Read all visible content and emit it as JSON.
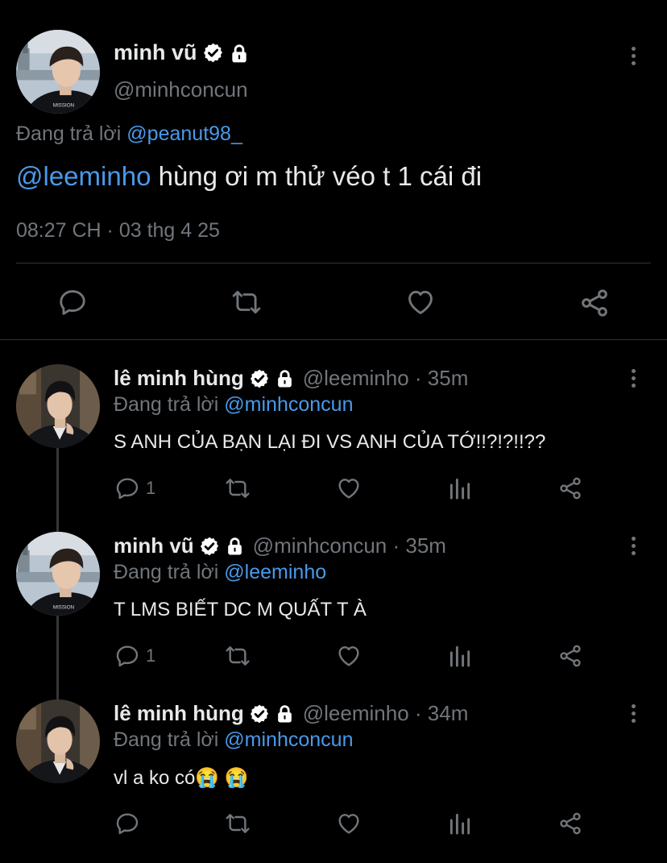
{
  "main_tweet": {
    "display_name": "minh vũ",
    "handle": "@minhconcun",
    "replying_prefix": "Đang trả lời",
    "replying_to": "@peanut98_",
    "mention": "@leeminho",
    "text": " hùng ơi m thử véo t 1 cái đi",
    "timestamp": "08:27 CH · 03 thg 4 25",
    "actions": [
      "reply-icon",
      "retweet-icon",
      "like-icon",
      "share-icon"
    ]
  },
  "replies": [
    {
      "display_name": "lê minh hùng",
      "meta": "@leeminho · 35m",
      "replying_prefix": "Đang trả lời",
      "replying_to": "@minhconcun",
      "text": "S ANH CỦA BẠN LẠI ĐI VS ANH CỦA TỚ!!?!?!!??",
      "reply_count": "1"
    },
    {
      "display_name": "minh vũ",
      "meta": "@minhconcun · 35m",
      "replying_prefix": "Đang trả lời",
      "replying_to": "@leeminho",
      "text": "T LMS BIẾT DC M QUẤT T À",
      "reply_count": "1"
    },
    {
      "display_name": "lê minh hùng",
      "meta": "@leeminho · 34m",
      "replying_prefix": "Đang trả lời",
      "replying_to": "@minhconcun",
      "text": "vl a ko có😭 😭",
      "reply_count": ""
    }
  ],
  "colors": {
    "background": "#000000",
    "text": "#e7e9ea",
    "muted": "#71767b",
    "link": "#4a99e9",
    "divider": "#2f3336"
  }
}
